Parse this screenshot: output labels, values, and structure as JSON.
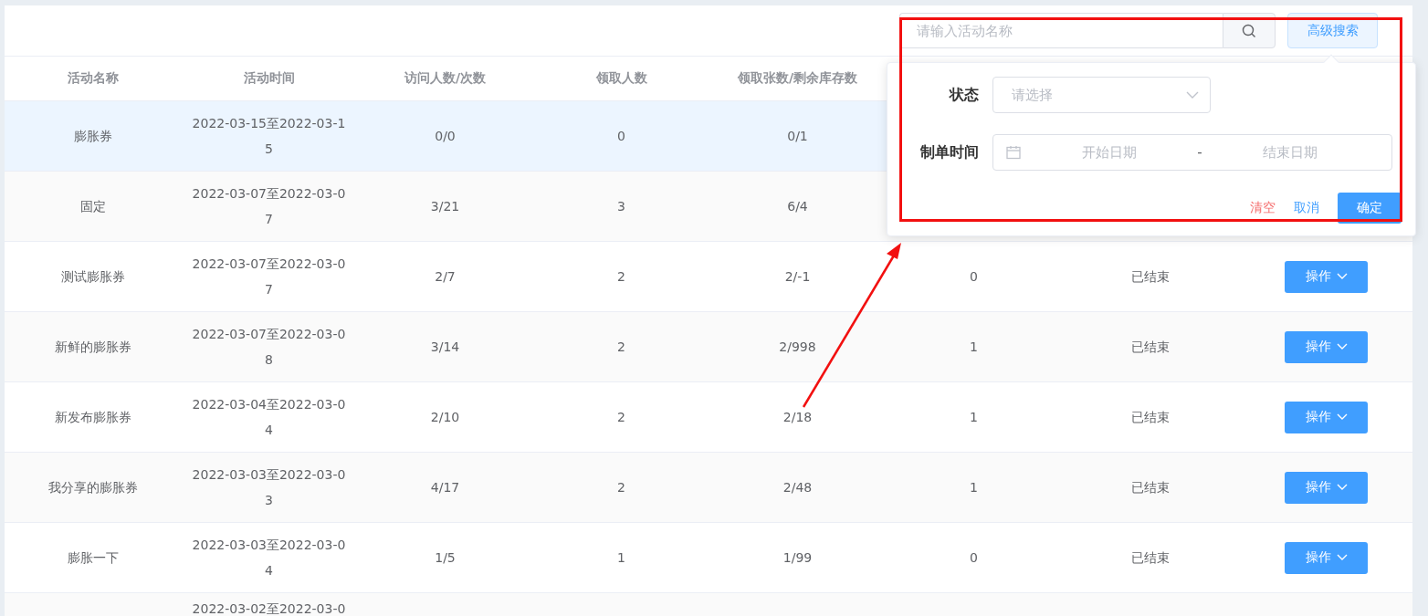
{
  "toolbar": {
    "search": {
      "placeholder": "请输入活动名称"
    },
    "advanced_button": "高级搜索"
  },
  "table": {
    "columns": [
      "活动名称",
      "活动时间",
      "访问人数/次数",
      "领取人数",
      "领取张数/剩余库存数"
    ],
    "rows": [
      {
        "selected": true,
        "name": "膨胀券",
        "time": "2022-03-15至2022-03-15",
        "visits": "0/0",
        "claimed": "0",
        "tickets": "0/1"
      },
      {
        "selected": false,
        "name": "固定",
        "time": "2022-03-07至2022-03-07",
        "visits": "3/21",
        "claimed": "3",
        "tickets": "6/4"
      },
      {
        "selected": false,
        "name": "测试膨胀券",
        "time": "2022-03-07至2022-03-07",
        "visits": "2/7",
        "claimed": "2",
        "tickets": "2/-1",
        "column_6": "0",
        "status": "已结束",
        "action": "操作"
      },
      {
        "selected": false,
        "name": "新鲜的膨胀券",
        "time": "2022-03-07至2022-03-08",
        "visits": "3/14",
        "claimed": "2",
        "tickets": "2/998",
        "column_6": "1",
        "status": "已结束",
        "action": "操作"
      },
      {
        "selected": false,
        "name": "新发布膨胀券",
        "time": "2022-03-04至2022-03-04",
        "visits": "2/10",
        "claimed": "2",
        "tickets": "2/18",
        "column_6": "1",
        "status": "已结束",
        "action": "操作"
      },
      {
        "selected": false,
        "name": "我分享的膨胀券",
        "time": "2022-03-03至2022-03-03",
        "visits": "4/17",
        "claimed": "2",
        "tickets": "2/48",
        "column_6": "1",
        "status": "已结束",
        "action": "操作"
      },
      {
        "selected": false,
        "name": "膨胀一下",
        "time": "2022-03-03至2022-03-04",
        "visits": "1/5",
        "claimed": "1",
        "tickets": "1/99",
        "column_6": "0",
        "status": "已结束",
        "action": "操作"
      },
      {
        "selected": false,
        "time": "2022-03-02至2022-03-0"
      }
    ]
  },
  "popover": {
    "fields": [
      {
        "kind": "select",
        "label": "状态",
        "placeholder": "请选择"
      },
      {
        "kind": "daterange",
        "label": "制单时间",
        "start_placeholder": "开始日期",
        "separator": "-",
        "end_placeholder": "结束日期"
      }
    ],
    "buttons": [
      {
        "kind": "danger",
        "label": "清空"
      },
      {
        "kind": "text",
        "label": "取消"
      },
      {
        "kind": "primary",
        "label": "确定"
      }
    ]
  }
}
